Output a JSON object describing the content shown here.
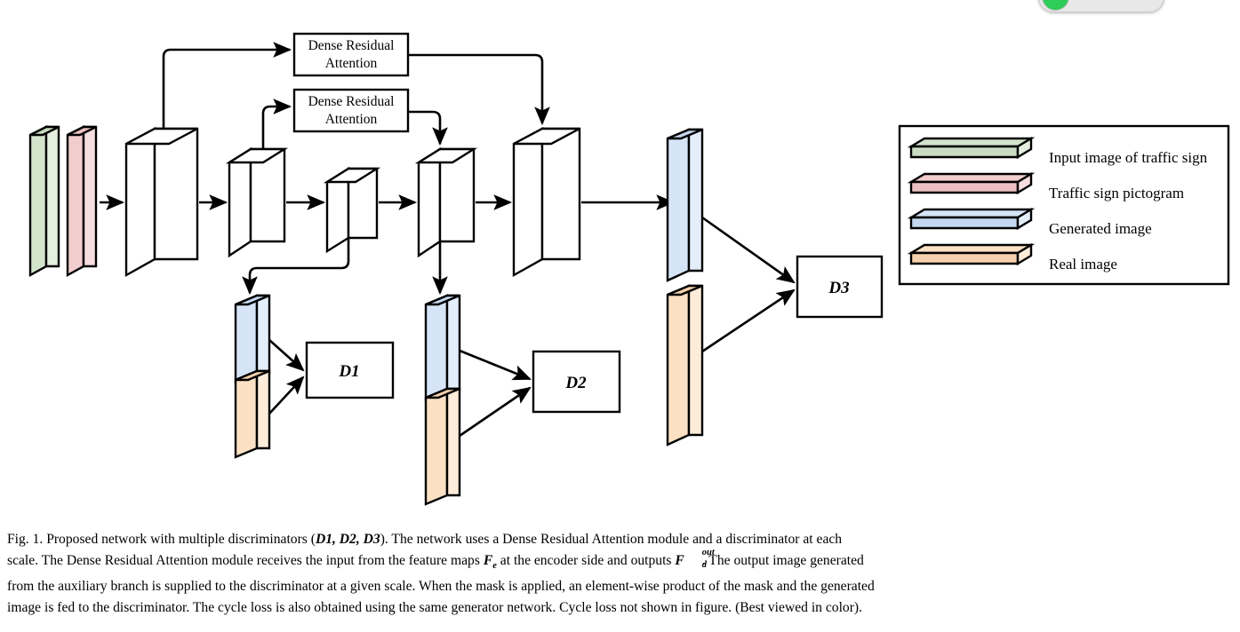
{
  "figure": {
    "id": "Fig. 1.",
    "modules": [
      {
        "name": "dra_top",
        "line1": "Dense Residual",
        "line2": "Attention"
      },
      {
        "name": "dra_bottom",
        "line1": "Dense Residual",
        "line2": "Attention"
      }
    ],
    "discriminators": [
      {
        "name": "d1",
        "label": "D1"
      },
      {
        "name": "d2",
        "label": "D2"
      },
      {
        "name": "d3",
        "label": "D3"
      }
    ],
    "legend": {
      "items": [
        {
          "label": "Input image of traffic sign",
          "color": "#d3e4cd",
          "side": "#e4efe0"
        },
        {
          "label": "Traffic sign pictogram",
          "color": "#f2cdcd",
          "side": "#f7dede"
        },
        {
          "label": "Generated image",
          "color": "#d6e4f7",
          "side": "#e4eefb"
        },
        {
          "label": "Real image",
          "color": "#fbe0c4",
          "side": "#fdecd9"
        }
      ]
    },
    "palette": {
      "input_green": "#d3e4cd",
      "pictogram_pink": "#f2cdcd",
      "generated_blue": "#d6e4f7",
      "real_orange": "#fbe0c4",
      "feature_white": "#ffffff",
      "stroke": "#000000"
    }
  },
  "caption": {
    "lines": [
      {
        "name": "caption-line-1",
        "parts": [
          {
            "t": "Fig. 1.   Proposed network with multiple discriminators ("
          },
          {
            "t": "D1, D2, D3",
            "style": "mathbold"
          },
          {
            "t": "). The network uses a Dense Residual Attention module and a discriminator at each"
          }
        ]
      },
      {
        "name": "caption-line-2",
        "parts": [
          {
            "t": "scale. The Dense Residual Attention module receives the input from the feature maps "
          },
          {
            "t": "Fe",
            "style": "F-sub-e"
          },
          {
            "t": " at the encoder side and outputs "
          },
          {
            "t": "Fd^out",
            "style": "F-sub-d-sup-out"
          },
          {
            "t": ". The output image generated"
          }
        ]
      },
      {
        "name": "caption-line-3",
        "parts": [
          {
            "t": "from the auxiliary branch is supplied to the discriminator at a given scale. When the mask is applied, an element-wise product of the mask and the generated"
          }
        ]
      },
      {
        "name": "caption-line-4",
        "parts": [
          {
            "t": "image is fed to the discriminator. The cycle loss is also obtained using the same generator network. Cycle loss not shown in figure. (Best viewed in color)."
          }
        ]
      }
    ],
    "symbols": {
      "Fe_base": "F",
      "Fe_sub": "e",
      "Fd_base": "F",
      "Fd_sub": "d",
      "Fd_sup": "out"
    }
  },
  "chrome": {
    "top_widget": {
      "name": "partial-toolbar-pill",
      "indicator_color": "#2ecc58"
    }
  }
}
